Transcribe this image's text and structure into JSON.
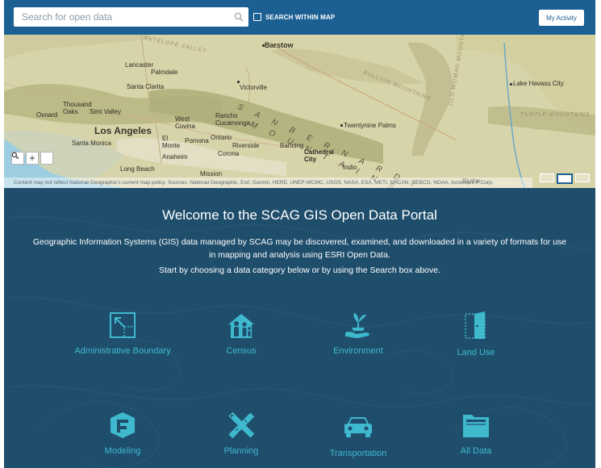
{
  "topbar": {
    "search_placeholder": "Search for open data",
    "within_map_label": "SEARCH WITHIN MAP",
    "activity_label": "My Activity"
  },
  "map": {
    "labels": {
      "barstow": "Barstow",
      "lancaster": "Lancaster",
      "palmdale": "Palmdale",
      "santa_clarita": "Santa Clarita",
      "victorville": "Victorville",
      "thousand_oaks": "Thousand\nOaks",
      "simi_valley": "Simi Valley",
      "oxnard": "Oxnard",
      "los_angeles": "Los Angeles",
      "west_covina": "West\nCovina",
      "rancho_cucamonga": "Rancho\nCucamonga",
      "santa_monica": "Santa Monica",
      "el_monte": "El\nMonte",
      "pomona": "Pomona",
      "ontario": "Ontario",
      "anaheim": "Anaheim",
      "riverside": "Riverside",
      "corona": "Corona",
      "banning": "Banning",
      "long_beach": "Long Beach",
      "twentynine_palms": "Twentynine Palms",
      "cathedral_city": "Cathedral\nCity",
      "indio": "Indio",
      "lake_havasu_city": "Lake Havasu City",
      "mission_viejo": "Mission",
      "blythe": "Blythe",
      "san_bernardino_range": "S A N   B E R N A R D I N O",
      "mountains_range": "M O U N T A I N S",
      "antelope_valley": "ANTELOPE VALLEY",
      "bullion_mountains": "BULLION MOUNTAINS",
      "old_woman_mountains": "OLD WOMAN MOUNTAINS",
      "turtle_mountains": "TURTLE MOUNTAINS"
    },
    "zoom_out": "-",
    "zoom_in": "+",
    "attribution": "Content may not reflect National Geographic's current map policy. Sources: National Geographic, Esri, Garmin, HERE, UNEP-WCMC, USGS, NASA, ESA, METI, NRCAN, GEBCO, NOAA, increment P Corp."
  },
  "welcome": {
    "title": "Welcome to the SCAG GIS Open Data Portal",
    "description_line1": "Geographic Information Systems (GIS) data managed by SCAG may be discovered, examined, and downloaded in a variety of formats for use",
    "description_line2": "in mapping and analysis using ESRI Open Data.",
    "start_text": "Start by choosing a data category below or by using the Search box above."
  },
  "categories": [
    {
      "label": "Administrative Boundary",
      "icon": "boundary-icon"
    },
    {
      "label": "Census",
      "icon": "family-icon"
    },
    {
      "label": "Environment",
      "icon": "plant-hand-icon"
    },
    {
      "label": "Land Use",
      "icon": "door-icon"
    },
    {
      "label": "Modeling",
      "icon": "sketch-icon"
    },
    {
      "label": "Planning",
      "icon": "ruler-pencil-icon"
    },
    {
      "label": "Transportation",
      "icon": "car-icon"
    },
    {
      "label": "All Data",
      "icon": "folder-icon"
    }
  ],
  "colors": {
    "header_bg": "#1c5f93",
    "section_bg": "#1f4e6c",
    "icon_accent": "#3fb9ce"
  }
}
